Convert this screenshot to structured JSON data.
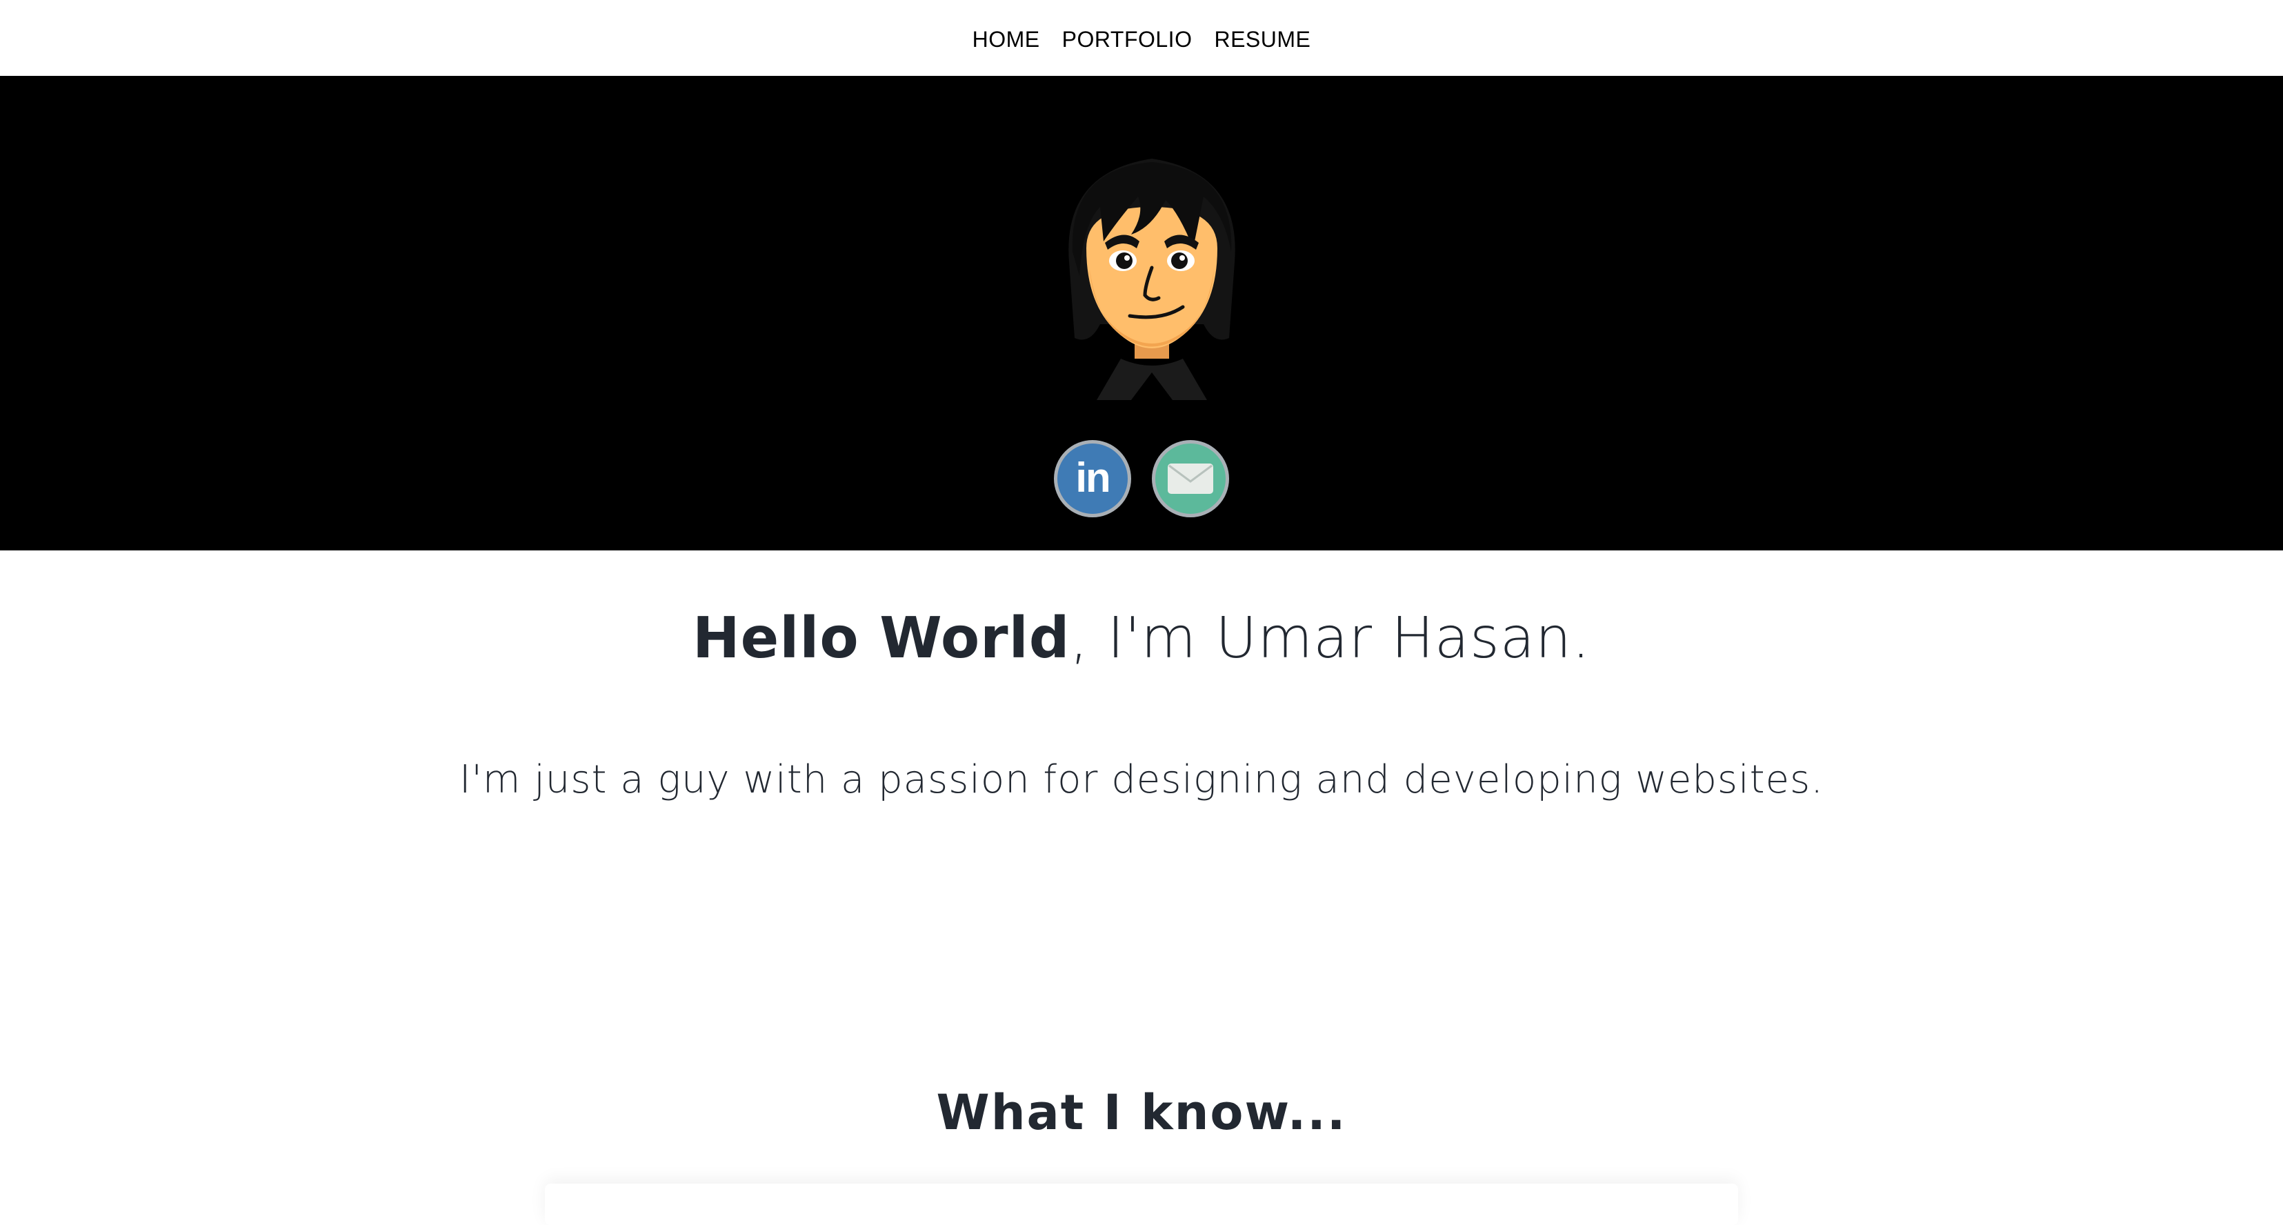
{
  "nav": {
    "items": [
      {
        "label": "HOME"
      },
      {
        "label": "PORTFOLIO"
      },
      {
        "label": "RESUME"
      }
    ]
  },
  "hero": {
    "background": "#000000",
    "avatar_icon": "mii-avatar",
    "social": [
      {
        "icon": "linkedin-icon",
        "label": "in",
        "color": "#3f7bb5"
      },
      {
        "icon": "email-icon",
        "color": "#5cb99b"
      }
    ]
  },
  "intro": {
    "greeting_bold": "Hello World",
    "greeting_rest": ", I'm Umar Hasan.",
    "tagline": "I'm just a guy with a passion for designing and developing websites."
  },
  "skills": {
    "title": "What I know..."
  }
}
